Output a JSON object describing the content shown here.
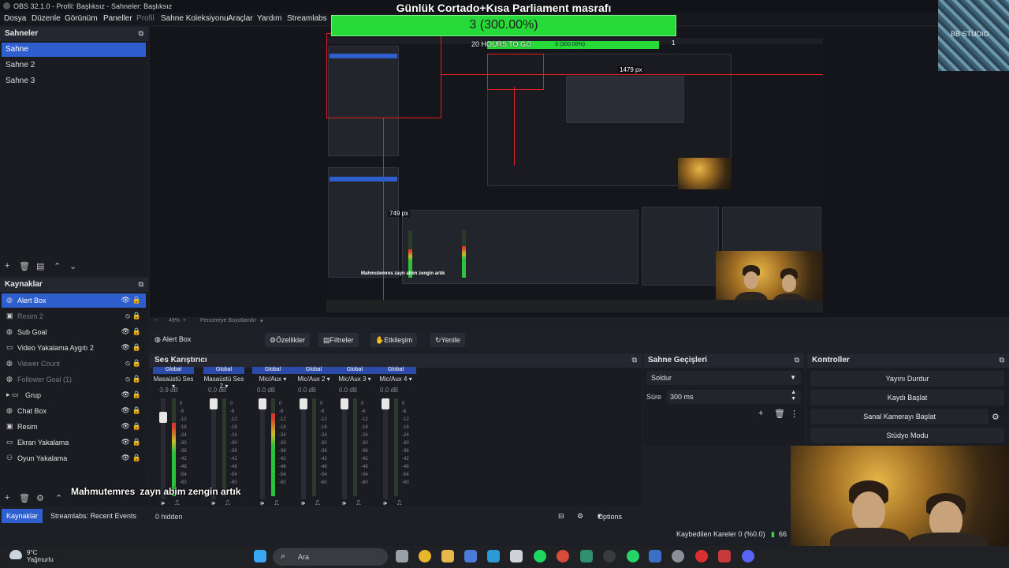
{
  "window": {
    "title": "OBS 32.1.0 - Profil: Başlıksız - Sahneler: Başlıksız"
  },
  "menu": {
    "items": [
      "Dosya",
      "Düzenle",
      "Görünüm",
      "Paneller",
      "Profil",
      "Sahne Koleksiyonu",
      "Araçlar",
      "Yardım",
      "Streamlabs"
    ]
  },
  "goal_overlay": {
    "title": "Günlük Cortado+Kısa Parliament masrafı",
    "value": "3 (300.00%)",
    "progress_fraction": 1.0,
    "color": "#28d93a"
  },
  "stream_thumb": {
    "label": "BB STUDIO"
  },
  "scenes": {
    "title": "Sahneler",
    "items": [
      "Sahne",
      "Sahne 2",
      "Sahne 3"
    ],
    "selected_index": 0
  },
  "sources": {
    "title": "Kaynaklar",
    "items": [
      {
        "name": "Alert Box",
        "visible": true,
        "selected": true,
        "icon": "globe-icon"
      },
      {
        "name": "Resim 2",
        "visible": false,
        "selected": false,
        "icon": "image-icon"
      },
      {
        "name": "Sub Goal",
        "visible": true,
        "selected": false,
        "icon": "globe-icon"
      },
      {
        "name": "Video Yakalama Aygıtı 2",
        "visible": true,
        "selected": false,
        "icon": "camera-icon"
      },
      {
        "name": "Viewer Count",
        "visible": false,
        "selected": false,
        "icon": "globe-icon"
      },
      {
        "name": "Follower Goal (1)",
        "visible": false,
        "selected": false,
        "icon": "globe-icon"
      },
      {
        "name": "Grup",
        "visible": true,
        "selected": false,
        "icon": "folder-icon"
      },
      {
        "name": "Chat Box",
        "visible": true,
        "selected": false,
        "icon": "globe-icon"
      },
      {
        "name": "Resim",
        "visible": true,
        "selected": false,
        "icon": "image-icon"
      },
      {
        "name": "Ekran Yakalama",
        "visible": true,
        "selected": false,
        "icon": "monitor-icon"
      },
      {
        "name": "Oyun Yakalama",
        "visible": true,
        "selected": false,
        "icon": "gamepad-icon"
      }
    ]
  },
  "bottom_tabs": {
    "tabs": [
      "Kaynaklar",
      "Streamlabs: Recent Events"
    ],
    "hidden_label": "0 hidden"
  },
  "preview": {
    "nested_goal": "20 HOURS TO GO",
    "nested_goal_value": "3 (300.00%)",
    "width_label": "1479 px",
    "height_label": "749 px",
    "footer_zoom": "49%",
    "footer_fit": "Pencereye Boyutlandır",
    "nested_chat_user": "Mahmutemres",
    "nested_chat_msg": "zayn abim zengin artık"
  },
  "context_bar": {
    "source": "Alert Box",
    "buttons": [
      "Özellikler",
      "Filtreler",
      "Etkileşim",
      "Yenile"
    ]
  },
  "mixer": {
    "title": "Ses Karıştırıcı",
    "channels": [
      {
        "tag": "Global",
        "name": "Masaüstü Ses",
        "db": "-3.9 dB",
        "fader": 0.85,
        "level": 0.75
      },
      {
        "tag": "Global",
        "name": "Masaüstü Ses 2",
        "db": "0.0 dB",
        "fader": 1.0,
        "level": 0.0
      },
      {
        "tag": "Global",
        "name": "Mic/Aux",
        "db": "0.0 dB",
        "fader": 1.0,
        "level": 0.85
      },
      {
        "tag": "Global",
        "name": "Mic/Aux 2",
        "db": "0.0 dB",
        "fader": 1.0,
        "level": 0.0
      },
      {
        "tag": "Global",
        "name": "Mic/Aux 3",
        "db": "0.0 dB",
        "fader": 1.0,
        "level": 0.0
      },
      {
        "tag": "Global",
        "name": "Mic/Aux 4",
        "db": "0.0 dB",
        "fader": 1.0,
        "level": 0.0
      }
    ],
    "scale": [
      "0",
      "-6",
      "-12",
      "-18",
      "-24",
      "-30",
      "-36",
      "-42",
      "-48",
      "-54",
      "-60"
    ],
    "options_label": "Options"
  },
  "chat": {
    "user": "Mahmutemres",
    "message": "zayn abim zengin artık"
  },
  "transitions": {
    "title": "Sahne Geçişleri",
    "selected": "Soldur",
    "duration_label": "Süre",
    "duration_value": "300 ms"
  },
  "controls": {
    "title": "Kontroller",
    "buttons": [
      "Yayını Durdur",
      "Kaydı Başlat",
      "Sanal Kamerayı Başlat",
      "Stüdyo Modu"
    ]
  },
  "status": {
    "dropped_frames": "Kaybedilen Kareler 0 (%0.0)",
    "bitrate_partial": "66"
  },
  "taskbar": {
    "weather_temp": "9°C",
    "weather_desc": "Yağmurlu",
    "search_placeholder": "Ara"
  }
}
